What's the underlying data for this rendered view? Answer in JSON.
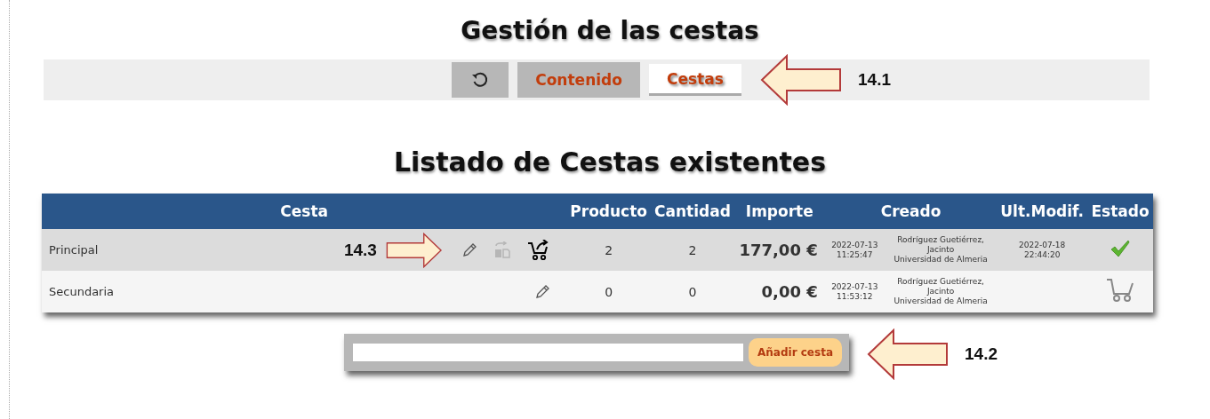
{
  "title": "Gestión de las cestas",
  "toolbar": {
    "tabs": [
      {
        "kind": "refresh",
        "selected": false
      },
      {
        "kind": "text",
        "label": "Contenido",
        "selected": false
      },
      {
        "kind": "text",
        "label": "Cestas",
        "selected": true
      }
    ],
    "callout": "14.1"
  },
  "heading": "Listado de Cestas existentes",
  "table": {
    "columns": [
      "Cesta",
      "Producto",
      "Cantidad",
      "Importe",
      "Creado",
      "Ult.Modif.",
      "Estado"
    ],
    "rows": [
      {
        "name": "Principal",
        "callout": "14.3",
        "actions": [
          {
            "kind": "edit",
            "disabled": false
          },
          {
            "kind": "transfer",
            "disabled": true
          },
          {
            "kind": "cart-send",
            "disabled": false
          }
        ],
        "producto": "2",
        "cantidad": "2",
        "importe": "177,00 €",
        "created_date": "2022-07-13",
        "created_time": "11:25:47",
        "creator": [
          "Rodríguez Guetiérrez,",
          "Jacinto",
          "Universidad de Almeria"
        ],
        "modified_date": "2022-07-18",
        "modified_time": "22:44:20",
        "status": {
          "kind": "check"
        }
      },
      {
        "name": "Secundaria",
        "actions": [
          {
            "kind": "edit",
            "disabled": false
          }
        ],
        "producto": "0",
        "cantidad": "0",
        "importe": "0,00 €",
        "created_date": "2022-07-13",
        "created_time": "11:53:12",
        "creator": [
          "Rodríguez Guetiérrez,",
          "Jacinto",
          "Universidad de Almeria"
        ],
        "status": {
          "kind": "cart"
        }
      }
    ]
  },
  "add_bar": {
    "button": "Añadir cesta",
    "callout": "14.2"
  }
}
